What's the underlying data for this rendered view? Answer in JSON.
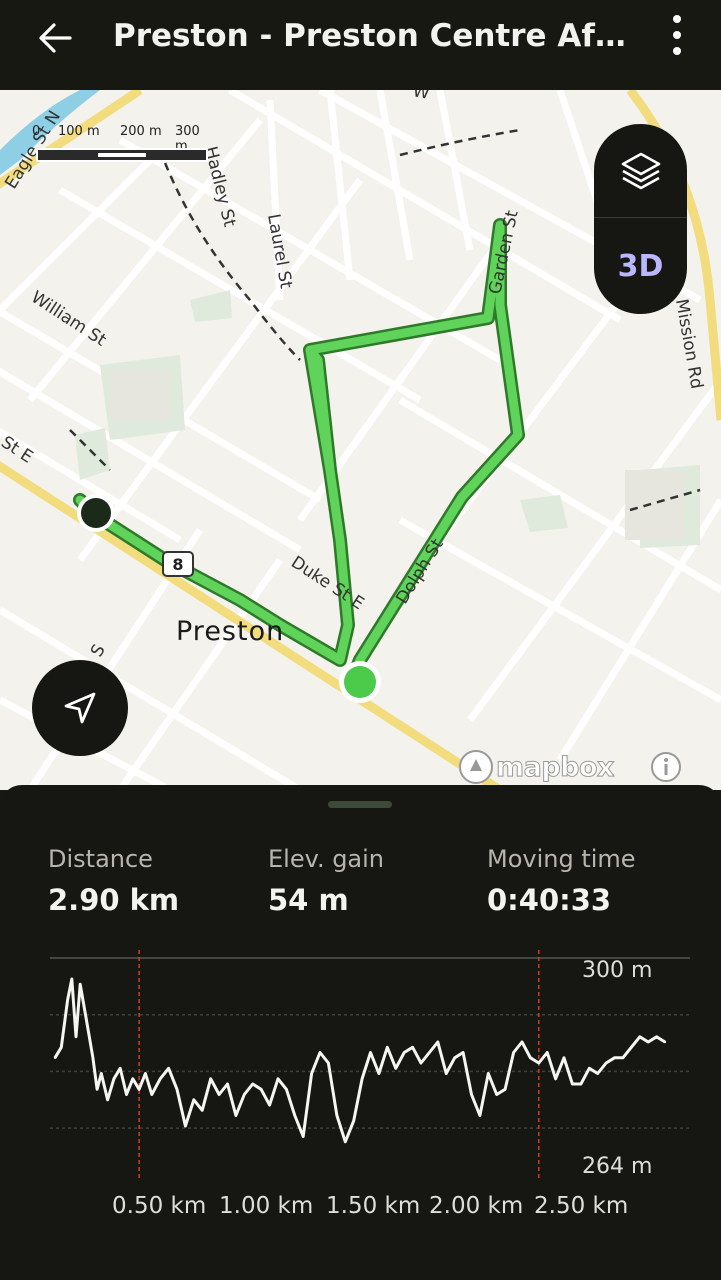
{
  "header": {
    "back_icon": "arrow-left-icon",
    "title": "Preston - Preston Centre Aftern…",
    "more_icon": "more-vertical-icon"
  },
  "map": {
    "scale": {
      "labels": [
        "0",
        "100 m",
        "200 m",
        "300 m"
      ]
    },
    "street_labels": {
      "eagle": "Eagle St N",
      "william": "William St",
      "laurel": "Laurel St",
      "hadley": "Hadley St",
      "garden": "Garden St",
      "mission": "Mission Rd",
      "duke": "Duke St E",
      "dolph": "Dolph St",
      "st_e": "St E",
      "s": "S",
      "w": "W"
    },
    "place_label": "Preston",
    "route_shield": "8",
    "controls": {
      "layers_icon": "layers-icon",
      "mode_3d": "3D",
      "locate_icon": "navigation-arrow-icon"
    },
    "attribution": "mapbox",
    "info_icon": "info-icon",
    "route_color": "#5fd35a",
    "route_outline": "#2e7a2a"
  },
  "stats": [
    {
      "label": "Distance",
      "value": "2.90 km"
    },
    {
      "label": "Elev. gain",
      "value": "54 m"
    },
    {
      "label": "Moving time",
      "value": "0:40:33"
    }
  ],
  "chart_data": {
    "type": "line",
    "title": "",
    "xlabel": "",
    "ylabel": "",
    "y_unit": "m",
    "y_axis_labels": [
      "300 m",
      "264 m"
    ],
    "x_tick_labels": [
      "0.50 km",
      "1.00 km",
      "1.50 km",
      "2.00 km",
      "2.50 km"
    ],
    "xlim": [
      0,
      2.9
    ],
    "ylim": [
      264,
      300
    ],
    "grid": true,
    "markers": [
      0.4,
      2.3
    ],
    "series": [
      {
        "x": [
          0.0,
          0.03,
          0.06,
          0.08,
          0.1,
          0.12,
          0.15,
          0.18,
          0.2,
          0.22,
          0.25,
          0.28,
          0.31,
          0.34,
          0.37,
          0.4,
          0.43,
          0.46,
          0.5,
          0.54,
          0.58,
          0.62,
          0.66,
          0.7,
          0.74,
          0.78,
          0.82,
          0.86,
          0.9,
          0.94,
          0.98,
          1.02,
          1.06,
          1.1,
          1.14,
          1.18,
          1.22,
          1.26,
          1.3,
          1.34,
          1.38,
          1.42,
          1.46,
          1.5,
          1.54,
          1.58,
          1.62,
          1.66,
          1.7,
          1.74,
          1.78,
          1.82,
          1.86,
          1.9,
          1.94,
          1.98,
          2.02,
          2.06,
          2.1,
          2.14,
          2.18,
          2.22,
          2.26,
          2.3,
          2.34,
          2.38,
          2.42,
          2.46,
          2.5,
          2.54,
          2.58,
          2.62,
          2.66,
          2.7,
          2.74,
          2.78,
          2.82,
          2.86,
          2.9
        ],
        "y": [
          283,
          285,
          294,
          298,
          287,
          297,
          290,
          283,
          277,
          280,
          275,
          279,
          281,
          276,
          279,
          277,
          280,
          276,
          279,
          281,
          277,
          270,
          275,
          273,
          279,
          276,
          278,
          272,
          276,
          278,
          277,
          274,
          279,
          277,
          272,
          268,
          280,
          284,
          282,
          272,
          267,
          271,
          279,
          284,
          280,
          285,
          281,
          284,
          285,
          282,
          284,
          286,
          280,
          283,
          284,
          276,
          272,
          280,
          276,
          277,
          284,
          286,
          283,
          282,
          284,
          279,
          283,
          278,
          278,
          281,
          280,
          282,
          283,
          283,
          285,
          287,
          286,
          287,
          286
        ]
      }
    ]
  }
}
